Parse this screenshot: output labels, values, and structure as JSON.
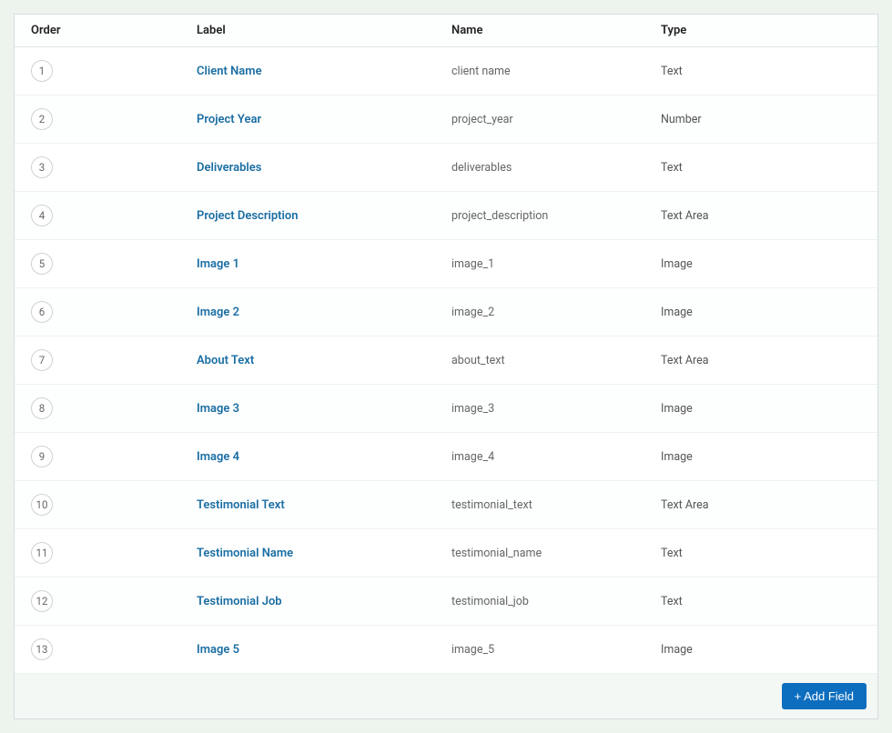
{
  "headers": {
    "order": "Order",
    "label": "Label",
    "name": "Name",
    "type": "Type"
  },
  "fields": [
    {
      "order": "1",
      "label": "Client Name",
      "name": "client name",
      "type": "Text"
    },
    {
      "order": "2",
      "label": "Project Year",
      "name": "project_year",
      "type": "Number"
    },
    {
      "order": "3",
      "label": "Deliverables",
      "name": "deliverables",
      "type": "Text"
    },
    {
      "order": "4",
      "label": "Project Description",
      "name": "project_description",
      "type": "Text Area"
    },
    {
      "order": "5",
      "label": "Image 1",
      "name": "image_1",
      "type": "Image"
    },
    {
      "order": "6",
      "label": "Image 2",
      "name": "image_2",
      "type": "Image"
    },
    {
      "order": "7",
      "label": "About Text",
      "name": "about_text",
      "type": "Text Area"
    },
    {
      "order": "8",
      "label": "Image 3",
      "name": "image_3",
      "type": "Image"
    },
    {
      "order": "9",
      "label": "Image 4",
      "name": "image_4",
      "type": "Image"
    },
    {
      "order": "10",
      "label": "Testimonial Text",
      "name": "testimonial_text",
      "type": "Text Area"
    },
    {
      "order": "11",
      "label": "Testimonial Name",
      "name": "testimonial_name",
      "type": "Text"
    },
    {
      "order": "12",
      "label": "Testimonial Job",
      "name": "testimonial_job",
      "type": "Text"
    },
    {
      "order": "13",
      "label": "Image 5",
      "name": "image_5",
      "type": "Image"
    }
  ],
  "footer": {
    "add_field": "+ Add Field"
  }
}
